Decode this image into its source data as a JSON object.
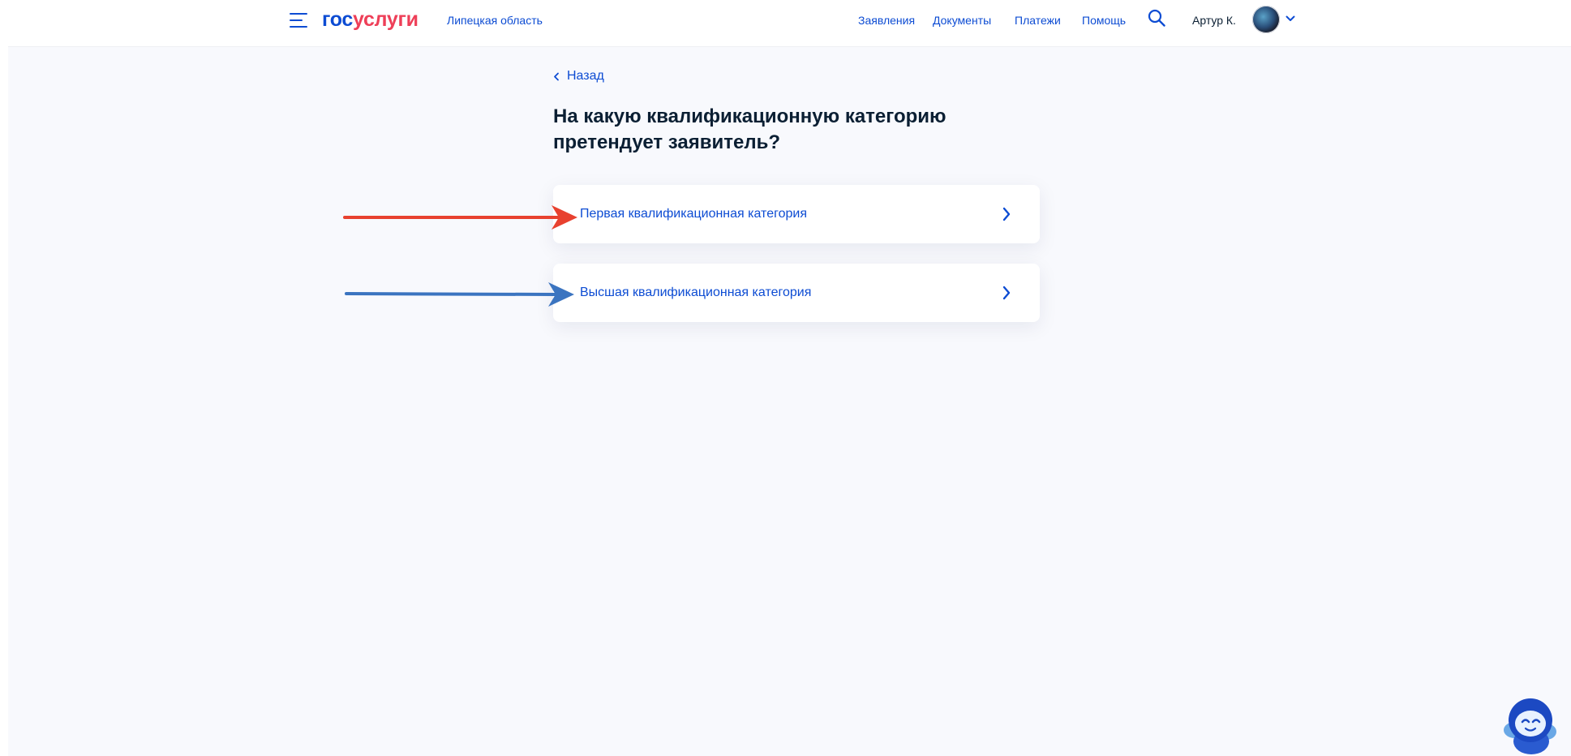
{
  "header": {
    "logo": {
      "part1": "гос",
      "part2": "услуги"
    },
    "region": "Липецкая область",
    "nav": [
      "Заявления",
      "Документы",
      "Платежи",
      "Помощь"
    ],
    "user_name": "Артур К.",
    "icons": {
      "menu": "burger-icon",
      "search": "search-icon",
      "account_menu": "chevron-down-icon"
    }
  },
  "back_label": "Назад",
  "question": "На какую квалификационную категорию претендует заявитель?",
  "options": [
    {
      "label": "Первая квалификационная категория"
    },
    {
      "label": "Высшая квалификационная категория"
    }
  ],
  "annotations": {
    "arrow1_color": "#e8412f",
    "arrow2_color": "#3b74c0"
  },
  "colors": {
    "brand_blue": "#0d4cd3",
    "brand_red": "#ee3f58",
    "text_dark": "#0b1f33",
    "page_bg": "#f8f9fd"
  }
}
